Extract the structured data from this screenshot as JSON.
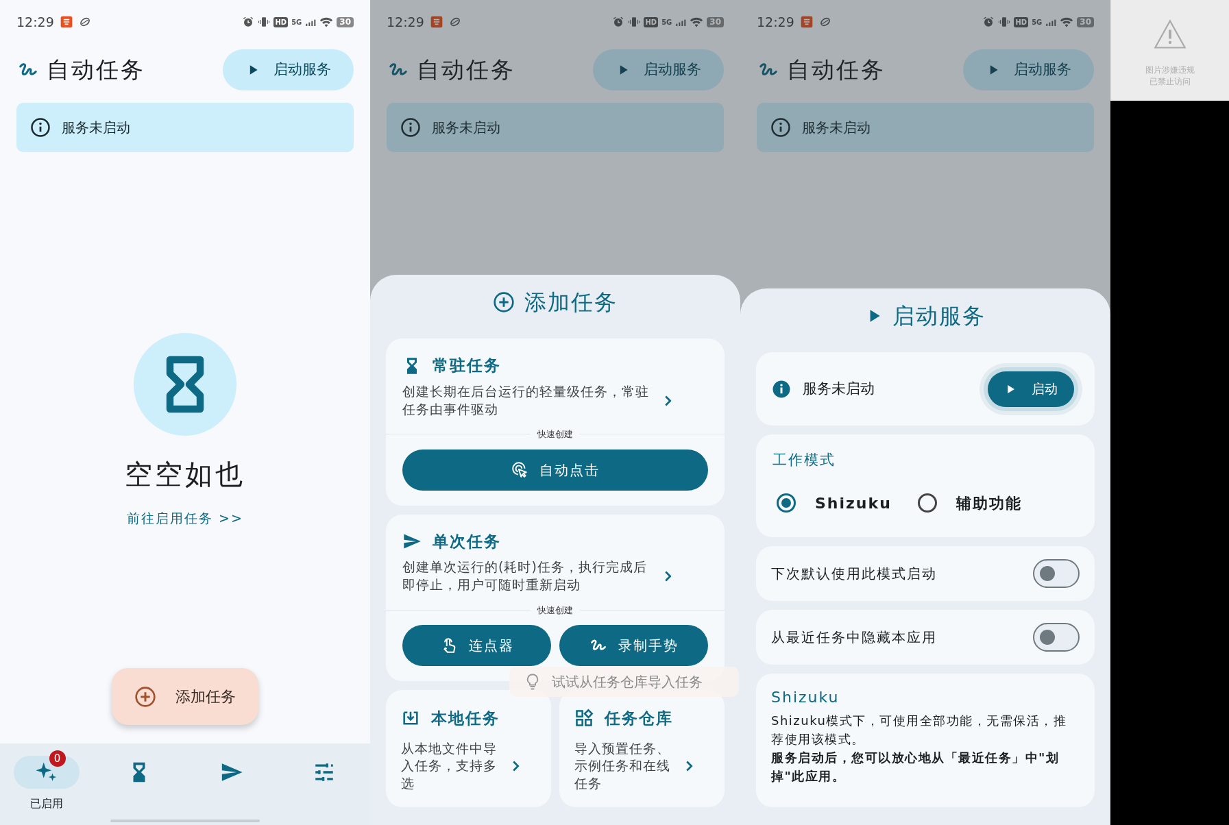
{
  "home_screen": {
    "status_bar": {
      "time": "12:29",
      "hd_label": "HD",
      "network_label": "5G",
      "battery": "30"
    },
    "app_bar": {
      "title": "自动任务",
      "action_button": "启动服务"
    },
    "banner": {
      "text": "服务未启动"
    },
    "empty_state": {
      "title": "空空如也",
      "link": "前往启用任务 >>"
    },
    "fab": {
      "label": "添加任务"
    },
    "bottom_nav": [
      {
        "kind": "sparkle",
        "selected": true,
        "label": "已启用",
        "badge": "0"
      },
      {
        "kind": "hourglass",
        "selected": false
      },
      {
        "kind": "send",
        "selected": false
      },
      {
        "kind": "tune",
        "selected": false
      }
    ]
  },
  "add_task_screen": {
    "status_bar": {
      "time": "12:29",
      "hd_label": "HD",
      "network_label": "5G",
      "battery": "30"
    },
    "background": {
      "title": "自动任务",
      "action_button": "启动服务",
      "banner": "服务未启动",
      "dimmed": true
    },
    "sheet": {
      "title": "添加任务",
      "cards": [
        {
          "kind": "hourglass",
          "title": "常驻任务",
          "description": "创建长期在后台运行的轻量级任务，常驻任务由事件驱动",
          "divider_label": "快速创建",
          "buttons": [
            {
              "kind": "click",
              "label": "自动点击"
            }
          ]
        },
        {
          "kind": "send",
          "title": "单次任务",
          "description": "创建单次运行的(耗时)任务，执行完成后即停止，用户可随时重新启动",
          "divider_label": "快速创建",
          "buttons": [
            {
              "kind": "touch",
              "label": "连点器"
            },
            {
              "kind": "squiggle",
              "label": "录制手势"
            }
          ]
        }
      ],
      "tiles": [
        {
          "kind": "download",
          "title": "本地任务",
          "description": "从本地文件中导入任务，支持多选"
        },
        {
          "kind": "apps",
          "title": "任务仓库",
          "description": "导入预置任务、示例任务和在线任务"
        }
      ]
    },
    "toast": {
      "text": "试试从任务仓库导入任务"
    }
  },
  "start_service_screen": {
    "status_bar": {
      "time": "12:29",
      "hd_label": "HD",
      "network_label": "5G",
      "battery": "30"
    },
    "background": {
      "title": "自动任务",
      "action_button": "启动服务",
      "banner": "服务未启动",
      "dimmed": true
    },
    "sheet": {
      "title": "启动服务",
      "status": {
        "text": "服务未启动",
        "button": "启动"
      },
      "mode": {
        "title": "工作模式",
        "options": [
          {
            "label": "Shizuku",
            "selected": true
          },
          {
            "label": "辅助功能",
            "selected": false
          }
        ]
      },
      "switches": [
        {
          "label": "下次默认使用此模式启动",
          "on": false
        },
        {
          "label": "从最近任务中隐藏本应用",
          "on": false
        }
      ],
      "info": {
        "title": "Shizuku",
        "text": "Shizuku模式下，可使用全部功能，无需保活，推荐使用该模式。",
        "note": "服务启动后，您可以放心地从「最近任务」中\"划掉\"此应用。"
      }
    }
  },
  "blocked_image": {
    "message": "图片涉嫌违规",
    "detail": "已禁止访问"
  }
}
